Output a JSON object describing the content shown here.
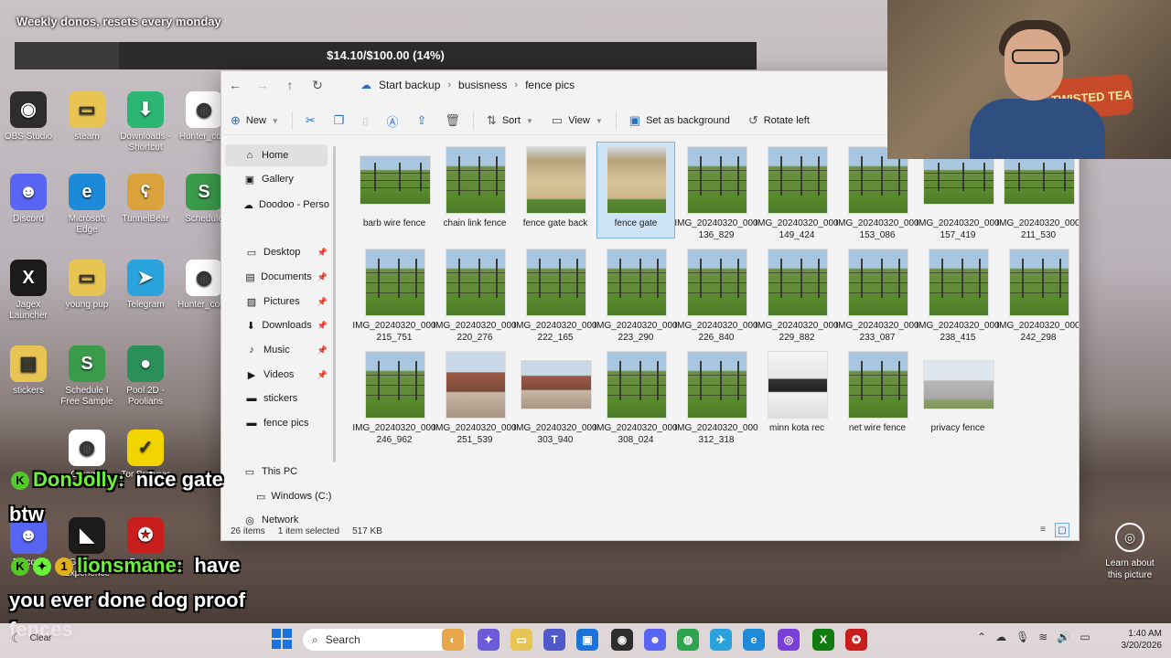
{
  "stream": {
    "dono_text": "Weekly donos, resets every monday",
    "dono_progress": "$14.10/$100.00 (14%)",
    "dono_fraction": 0.14,
    "webcam_sign": "TWISTED TEA"
  },
  "desktop_icons": [
    {
      "label": "OBS Studio",
      "glyph": "◉",
      "color": "#2d2d2d"
    },
    {
      "label": "steam",
      "glyph": "▭",
      "color": "#e8c452"
    },
    {
      "label": "Downloads - Shortcut",
      "glyph": "⬇",
      "color": "#2bb673"
    },
    {
      "label": "Hunter_co...",
      "glyph": "◍",
      "color": "#ffffff"
    },
    {
      "label": "Discord",
      "glyph": "☻",
      "color": "#5865f2"
    },
    {
      "label": "Microsoft Edge",
      "glyph": "e",
      "color": "#1c8ad8"
    },
    {
      "label": "TunnelBear",
      "glyph": "ʕ",
      "color": "#d9a23b"
    },
    {
      "label": "Schedule",
      "glyph": "S",
      "color": "#3a9b4a"
    },
    {
      "label": "Jagex Launcher",
      "glyph": "X",
      "color": "#1b1b1b"
    },
    {
      "label": "young pup",
      "glyph": "▭",
      "color": "#e8c452"
    },
    {
      "label": "Telegram",
      "glyph": "➤",
      "color": "#2aa3dd"
    },
    {
      "label": "Hunter_cou...Julio",
      "glyph": "◍",
      "color": "#ffffff"
    },
    {
      "label": "stickers",
      "glyph": "▤",
      "color": "#e8c452"
    },
    {
      "label": "Schedule I Free Sample",
      "glyph": "S",
      "color": "#3a9b4a"
    },
    {
      "label": "Pool 2D - Poolians",
      "glyph": "●",
      "color": "#2a8f58"
    },
    {
      "label": "Chrome",
      "glyph": "◍",
      "color": "#ffffff"
    },
    {
      "label": "Tor Browser",
      "glyph": "✓",
      "color": "#f2d400"
    },
    {
      "label": "Discord",
      "glyph": "☻",
      "color": "#5865f2"
    },
    {
      "label": "GeForce Experience",
      "glyph": "◣",
      "color": "#1b1b1b"
    },
    {
      "label": "Booster",
      "glyph": "✪",
      "color": "#c81e1e"
    }
  ],
  "explorer": {
    "breadcrumb": [
      "Start backup",
      "busisness",
      "fence pics"
    ],
    "toolbar": {
      "new": "New",
      "sort": "Sort",
      "view": "View",
      "set_background": "Set as background",
      "rotate_left": "Rotate left"
    },
    "nav": [
      {
        "label": "Home",
        "icon": "⌂",
        "selected": true
      },
      {
        "label": "Gallery",
        "icon": "▣"
      },
      {
        "label": "Doodoo - Perso",
        "icon": "☁"
      },
      {
        "label": "Desktop",
        "icon": "▭",
        "pinned": true
      },
      {
        "label": "Documents",
        "icon": "▤",
        "pinned": true
      },
      {
        "label": "Pictures",
        "icon": "▨",
        "pinned": true
      },
      {
        "label": "Downloads",
        "icon": "⬇",
        "pinned": true
      },
      {
        "label": "Music",
        "icon": "♪",
        "pinned": true
      },
      {
        "label": "Videos",
        "icon": "▶",
        "pinned": true
      },
      {
        "label": "stickers",
        "icon": "▬"
      },
      {
        "label": "fence pics",
        "icon": "▬"
      },
      {
        "label": "This PC",
        "icon": "▭"
      },
      {
        "label": "Windows (C:)",
        "icon": "▭"
      },
      {
        "label": "Network",
        "icon": "◎"
      }
    ],
    "files": [
      {
        "name": "barb wire fence",
        "kind": "wide"
      },
      {
        "name": "chain link fence",
        "kind": "tall"
      },
      {
        "name": "fence gate back",
        "kind": "gate"
      },
      {
        "name": "fence gate",
        "kind": "gate",
        "selected": true
      },
      {
        "name": "IMG_20240320_000136_829",
        "kind": "tall"
      },
      {
        "name": "IMG_20240320_000149_424",
        "kind": "tall"
      },
      {
        "name": "IMG_20240320_000153_086",
        "kind": "tall"
      },
      {
        "name": "IMG_20240320_000157_419",
        "kind": "wide"
      },
      {
        "name": "IMG_20240320_000211_530",
        "kind": "wide"
      },
      {
        "name": "IMG_20240320_000215_751",
        "kind": "tall"
      },
      {
        "name": "IMG_20240320_000220_276",
        "kind": "tall"
      },
      {
        "name": "IMG_20240320_000222_165",
        "kind": "tall"
      },
      {
        "name": "IMG_20240320_000223_290",
        "kind": "tall"
      },
      {
        "name": "IMG_20240320_000226_840",
        "kind": "tall"
      },
      {
        "name": "IMG_20240320_000229_882",
        "kind": "tall"
      },
      {
        "name": "IMG_20240320_000233_087",
        "kind": "tall"
      },
      {
        "name": "IMG_20240320_000238_415",
        "kind": "tall"
      },
      {
        "name": "IMG_20240320_000242_298",
        "kind": "tall"
      },
      {
        "name": "IMG_20240320_000246_962",
        "kind": "tall"
      },
      {
        "name": "IMG_20240320_000251_539",
        "kind": "house"
      },
      {
        "name": "IMG_20240320_000303_940",
        "kind": "housewide"
      },
      {
        "name": "IMG_20240320_000308_024",
        "kind": "tall"
      },
      {
        "name": "IMG_20240320_000312_318",
        "kind": "tall"
      },
      {
        "name": "minn kota rec",
        "kind": "bw"
      },
      {
        "name": "net wire fence",
        "kind": "tall"
      },
      {
        "name": "privacy fence",
        "kind": "priv"
      }
    ],
    "status": {
      "count": "26 items",
      "selected": "1 item selected",
      "size": "517 KB"
    }
  },
  "chat": [
    {
      "user": "DonJolly:",
      "message": "nice gate",
      "cont": "btw"
    },
    {
      "user": "lionsmane:",
      "message": "have",
      "cont": "you ever done dog proof",
      "cont2": "fences"
    }
  ],
  "learn_about": "Learn about this picture",
  "taskbar": {
    "weather": "Clear",
    "search_placeholder": "Search",
    "time": "1:40 AM",
    "date": "3/20/2026"
  }
}
